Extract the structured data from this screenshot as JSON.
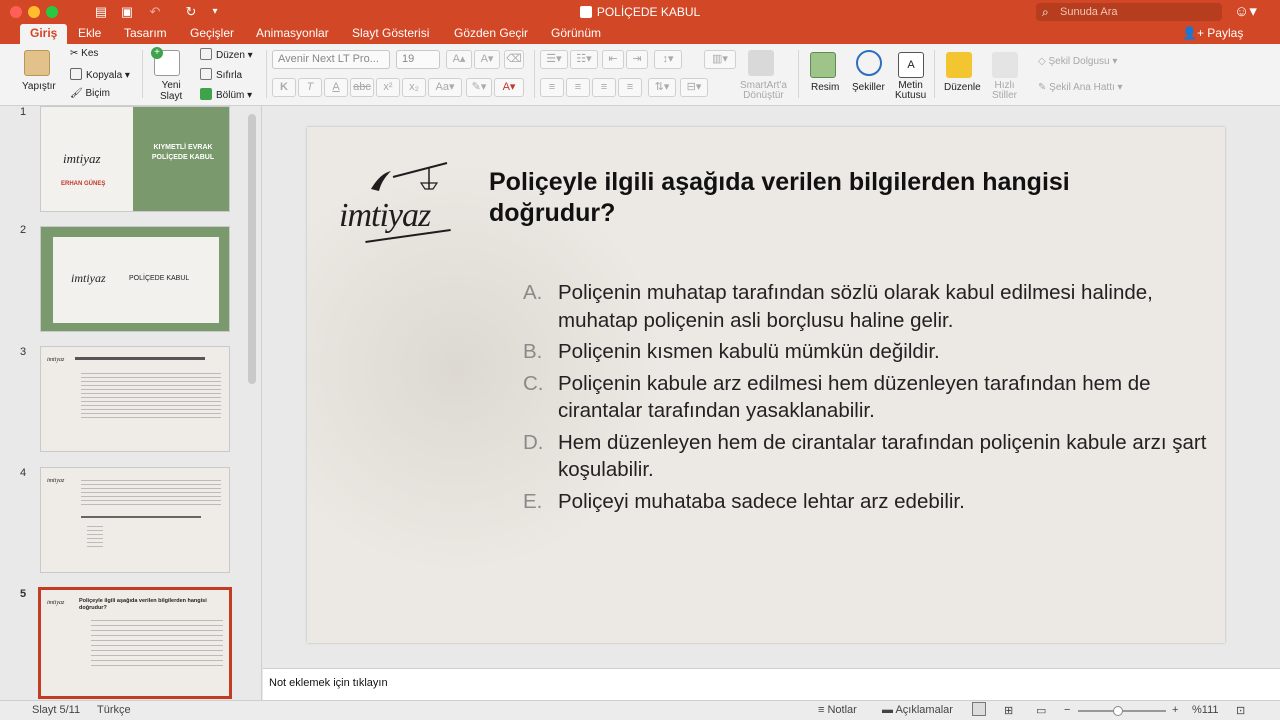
{
  "window": {
    "title": "POLİÇEDE KABUL",
    "search_placeholder": "Sunuda Ara"
  },
  "tabs": [
    "Giriş",
    "Ekle",
    "Tasarım",
    "Geçişler",
    "Animasyonlar",
    "Slayt Gösterisi",
    "Gözden Geçir",
    "Görünüm"
  ],
  "share_label": "Paylaş",
  "ribbon": {
    "paste": "Yapıştır",
    "cut": "Kes",
    "copy": "Kopyala",
    "format": "Biçim",
    "new_slide_line1": "Yeni",
    "new_slide_line2": "Slayt",
    "layout": "Düzen",
    "reset": "Sıfırla",
    "section": "Bölüm",
    "font_name": "Avenir Next LT Pro...",
    "font_size": "19",
    "bold": "K",
    "italic": "T",
    "underline": "A",
    "strike": "abc",
    "smartart_line1": "SmartArt'a",
    "smartart_line2": "Dönüştür",
    "picture": "Resim",
    "shapes": "Şekiller",
    "textbox_line1": "Metin",
    "textbox_line2": "Kutusu",
    "arrange": "Düzenle",
    "quick_styles_line1": "Hızlı",
    "quick_styles_line2": "Stiller",
    "shape_fill": "Şekil Dolgusu",
    "shape_outline": "Şekil Ana Hattı"
  },
  "thumbnails": [
    {
      "num": "1",
      "title": "KIYMETLİ EVRAK POLİÇEDE KABUL",
      "author": "ERHAN GÜNEŞ",
      "logo": "imtiyaz"
    },
    {
      "num": "2",
      "title": "POLİÇEDE KABUL",
      "logo": "imtiyaz"
    },
    {
      "num": "3",
      "logo": "imtiyaz"
    },
    {
      "num": "4",
      "logo": "imtiyaz"
    },
    {
      "num": "5",
      "title": "Poliçeyle ilgili aşağıda verilen bilgilerden hangisi doğrudur?",
      "logo": "imtiyaz"
    }
  ],
  "slide": {
    "logo": "imtiyaz",
    "title": "Poliçeyle ilgili aşağıda verilen bilgilerden hangisi doğrudur?",
    "answers": [
      {
        "letter": "A.",
        "text": "Poliçenin muhatap tarafından sözlü olarak kabul edilmesi halinde, muhatap poliçenin asli borçlusu haline gelir."
      },
      {
        "letter": "B.",
        "text": "Poliçenin kısmen kabulü mümkün değildir."
      },
      {
        "letter": "C.",
        "text": "Poliçenin kabule arz edilmesi hem düzenleyen tarafından hem de cirantalar tarafından yasaklanabilir."
      },
      {
        "letter": "D.",
        "text": "Hem düzenleyen hem de cirantalar tarafından poliçenin kabule arzı şart koşulabilir."
      },
      {
        "letter": "E.",
        "text": "Poliçeyi muhataba sadece lehtar arz edebilir."
      }
    ]
  },
  "notes_placeholder": "Not eklemek için tıklayın",
  "status": {
    "slide": "Slayt 5/11",
    "language": "Türkçe",
    "notes": "Notlar",
    "comments": "Açıklamalar",
    "zoom": "%111",
    "zoom_level": 0.45
  }
}
